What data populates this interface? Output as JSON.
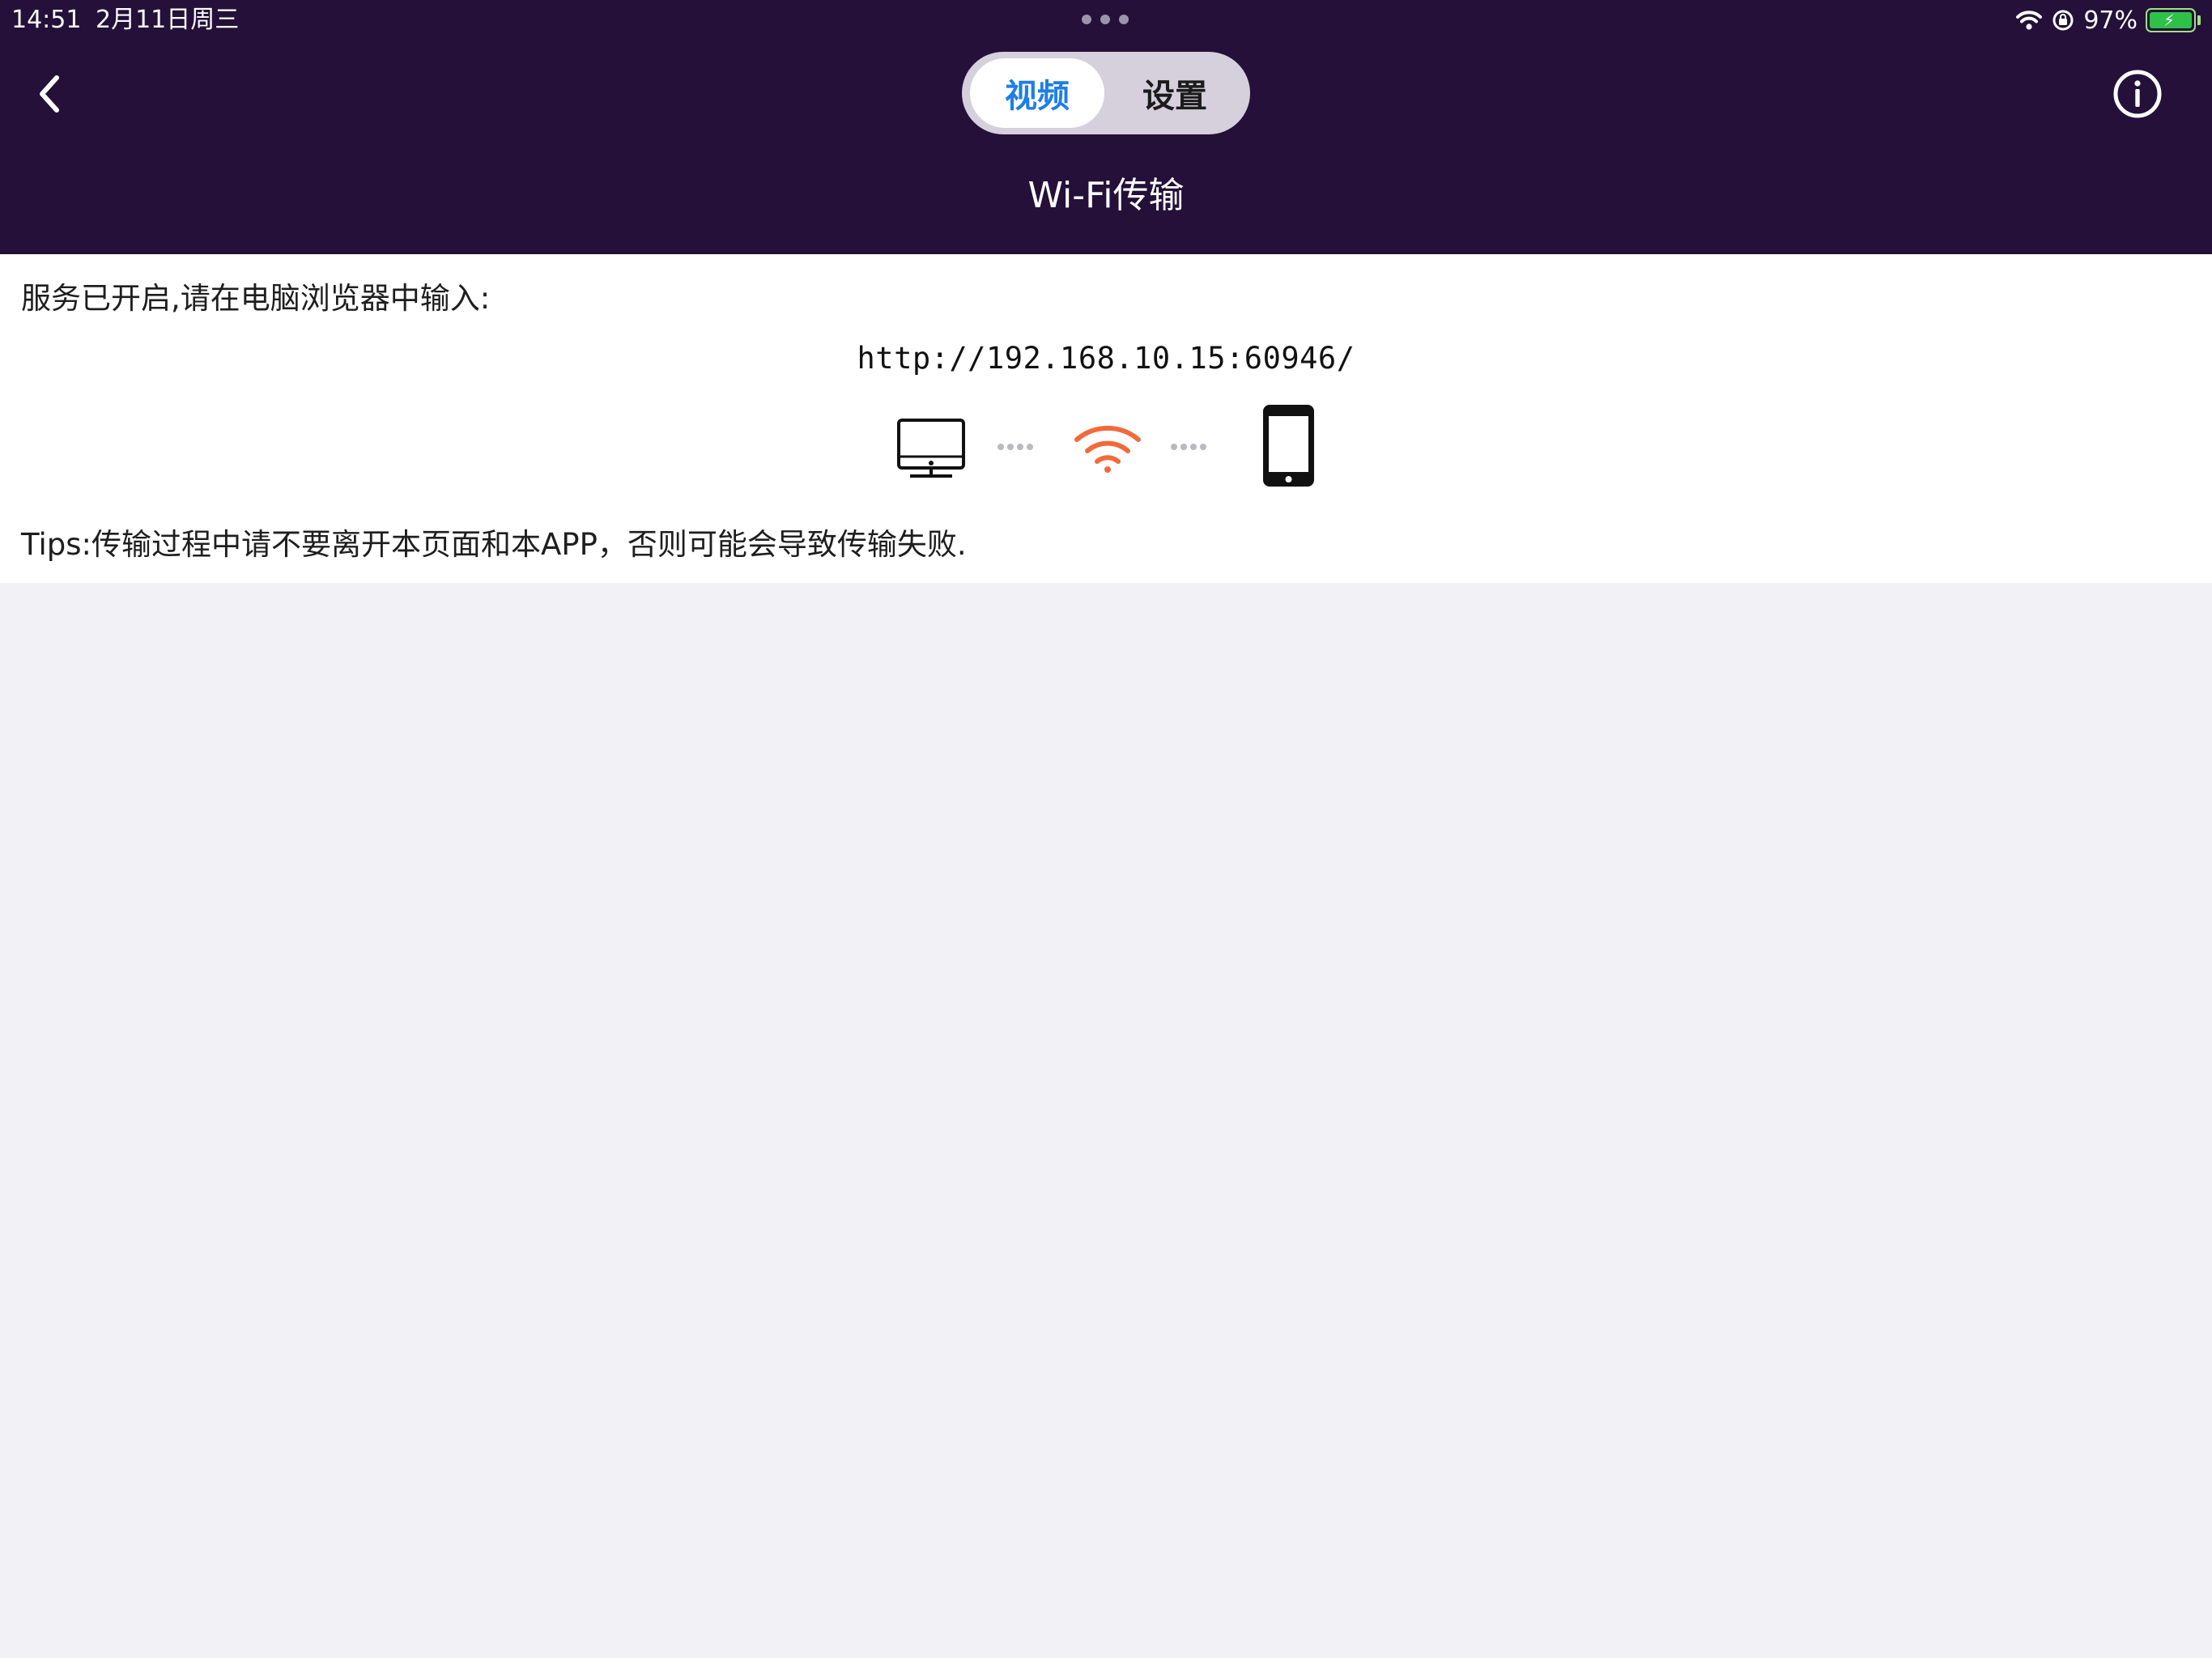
{
  "status_bar": {
    "time": "14:51",
    "date": "2月11日周三",
    "battery_percent": "97%",
    "wifi_icon": "wifi-icon",
    "orientation_lock_icon": "orientation-lock-icon",
    "battery_level": 0.97
  },
  "nav": {
    "back_icon": "chevron-left-icon",
    "tabs": [
      {
        "label": "视频",
        "active": true
      },
      {
        "label": "设置",
        "active": false
      }
    ],
    "info_icon": "info-icon",
    "title": "Wi-Fi传输"
  },
  "content": {
    "service_text": "服务已开启,请在电脑浏览器中输入:",
    "url": "http://192.168.10.15:60946/",
    "diagram_icons": [
      "computer-icon",
      "wifi-icon",
      "phone-icon"
    ],
    "tips": "Tips:传输过程中请不要离开本页面和本APP，否则可能会导致传输失败."
  },
  "colors": {
    "header_bg": "#241039",
    "accent_blue": "#1e7ee6",
    "wifi_orange": "#f26a3c",
    "page_bg": "#f1f1f6"
  }
}
